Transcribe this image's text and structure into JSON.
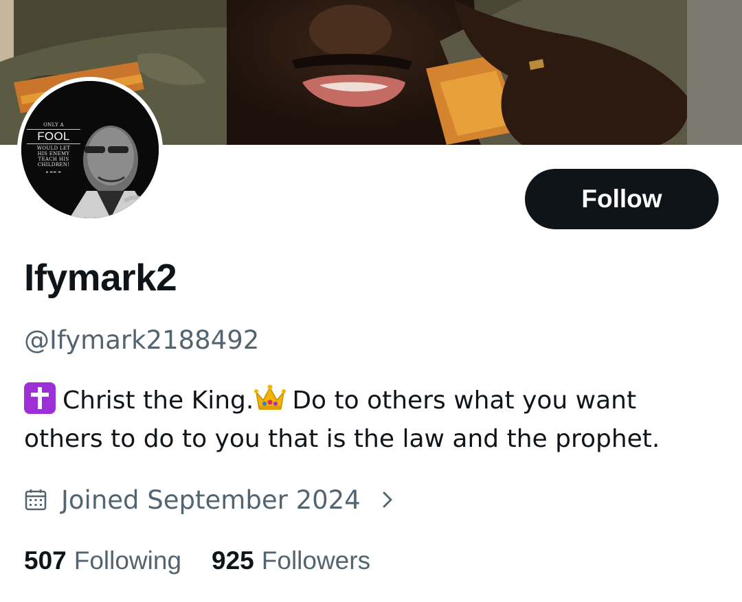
{
  "profile": {
    "display_name": "Ifymark2",
    "handle": "@Ifymark2188492",
    "bio_text_1": "Christ the King.",
    "bio_text_2": "Do to others what you want others to do to you that is the law and the prophet.",
    "bio_emoji_1": "latin-cross-icon",
    "bio_emoji_2": "crown-icon",
    "joined": "Joined September 2024",
    "following_count": "507",
    "following_label": "Following",
    "followers_count": "925",
    "followers_label": "Followers"
  },
  "avatar": {
    "quote_top": "ONLY A",
    "quote_main": "FOOL",
    "quote_lines": [
      "WOULD LET",
      "HIS ENEMY",
      "TEACH HIS",
      "CHILDREN!"
    ]
  },
  "actions": {
    "follow_label": "Follow"
  },
  "colors": {
    "primary_text": "#0f1419",
    "secondary_text": "#536471",
    "button_bg": "#0f1419",
    "button_text": "#ffffff",
    "emoji_purple": "#9c2fd6"
  },
  "icons": [
    "calendar-icon",
    "chevron-right-icon"
  ]
}
